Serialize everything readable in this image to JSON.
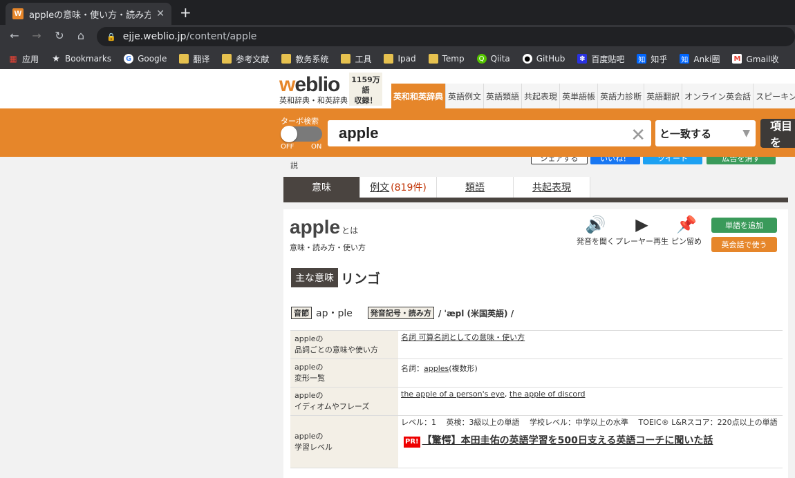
{
  "browser": {
    "tab_title": "appleの意味・使い方・読み方 |",
    "tab_favicon": "W",
    "url_host": "ejje.weblio.jp",
    "url_path": "/content/apple",
    "bookmarks": [
      {
        "label": "应用",
        "icon": "apps-grid-icon"
      },
      {
        "label": "Bookmarks",
        "icon": "star-icon"
      },
      {
        "label": "Google",
        "icon": "google-icon"
      },
      {
        "label": "翻译",
        "icon": "folder-icon"
      },
      {
        "label": "参考文献",
        "icon": "folder-icon"
      },
      {
        "label": "教务系统",
        "icon": "folder-icon"
      },
      {
        "label": "工具",
        "icon": "folder-icon"
      },
      {
        "label": "Ipad",
        "icon": "folder-icon"
      },
      {
        "label": "Temp",
        "icon": "folder-icon"
      },
      {
        "label": "Qiita",
        "icon": "qiita-icon"
      },
      {
        "label": "GitHub",
        "icon": "github-icon"
      },
      {
        "label": "百度贴吧",
        "icon": "baidu-icon"
      },
      {
        "label": "知乎",
        "icon": "zhihu-icon"
      },
      {
        "label": "Anki圈",
        "icon": "zhihu-icon"
      },
      {
        "label": "Gmail收",
        "icon": "gmail-icon"
      }
    ]
  },
  "header": {
    "logo_w": "w",
    "logo_rest": "eblio",
    "logo_sub": "英和辞典・和英辞典",
    "count_line1": "1159万",
    "count_line2": "語",
    "count_line3": "収録！",
    "nav_tabs": [
      "英和和英辞典",
      "英語例文",
      "英語類語",
      "共起表現",
      "英単語帳",
      "英語力診断",
      "英語翻訳",
      "オンライン英会話",
      "スピーキングテ"
    ]
  },
  "search": {
    "turbo_label": "ターボ検索",
    "off_label": "OFF",
    "on_label": "ON",
    "query": "apple",
    "match_mode": "と一致する",
    "button_label": "項目を"
  },
  "subrow": {
    "fragment": "説",
    "share_label": "シェアする",
    "like_label": "いいね！",
    "tweet_label": "ツイート",
    "ad_label": "広告を消す"
  },
  "content_tabs": [
    {
      "label": "意味",
      "count": ""
    },
    {
      "label": "例文",
      "count": "(819件)"
    },
    {
      "label": "類語",
      "count": ""
    },
    {
      "label": "共起表現",
      "count": ""
    }
  ],
  "entry": {
    "word": "apple",
    "toha": "とは",
    "subtitle": "意味・読み方・使い方",
    "tools": [
      {
        "label": "発音を聞く",
        "icon": "speaker-icon"
      },
      {
        "label": "プレーヤー再生",
        "icon": "play-icon"
      },
      {
        "label": "ピン留め",
        "icon": "pin-icon"
      }
    ],
    "add_word": "単語を追加",
    "use_conversation": "英会話で使う",
    "meaning_label": "主な意味",
    "meaning": "リンゴ",
    "syllable_label": "音節",
    "syllable": "ap・ple",
    "pron_label": "発音記号・読み方",
    "pron": "/ ˈæpl (米国英語) /"
  },
  "info_rows": [
    {
      "h1": "appleの",
      "h2": "品詞ごとの意味や使い方",
      "value": "名詞 可算名詞としての意味・使い方"
    },
    {
      "h1": "appleの",
      "h2": "変形一覧",
      "value_prefix": "名詞：",
      "value_link": "apples",
      "value_suffix": "(複数形)"
    },
    {
      "h1": "appleの",
      "h2": "イディオムやフレーズ",
      "link1": "the apple of a person's eye",
      "sep": ", ",
      "link2": "the apple of discord"
    },
    {
      "h1": "appleの",
      "h2": "学習レベル",
      "value": "レベル：1　 英検：3級以上の単語　 学校レベル：中学以上の水準　 TOEIC® L&Rスコア：220点以上の単語",
      "pr_badge": "PR!",
      "pr_text": "【驚愕】本田圭佑の英語学習を500日支える英語コーチに聞いた話"
    }
  ],
  "colors": {
    "accent": "#e6862a",
    "dark": "#4a4440",
    "green": "#3a9a5a"
  }
}
